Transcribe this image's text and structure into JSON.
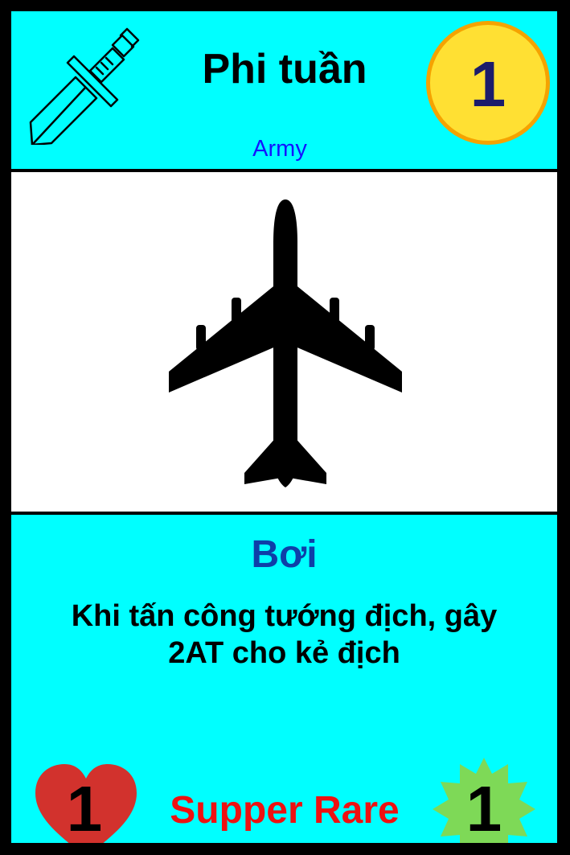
{
  "card": {
    "name": "Phi tuần",
    "type": "Army",
    "cost": "1",
    "ability_name": "Bơi",
    "ability_line1": "Khi tấn công tướng địch, gây",
    "ability_line2": "2AT cho kẻ địch",
    "health": "1",
    "rarity": "Supper Rare",
    "attack": "1"
  },
  "icons": {
    "top_left": "sword-icon",
    "art": "airplane-icon",
    "health": "heart-icon",
    "attack": "starburst-icon"
  },
  "colors": {
    "panel": "#00FFFF",
    "type_text": "#1414FF",
    "ability_name": "#0E3FA8",
    "rarity_text": "#EE1111",
    "coin_fill": "#FFE033",
    "coin_border": "#F5A300",
    "heart": "#D2322D",
    "starburst": "#7ED957"
  }
}
